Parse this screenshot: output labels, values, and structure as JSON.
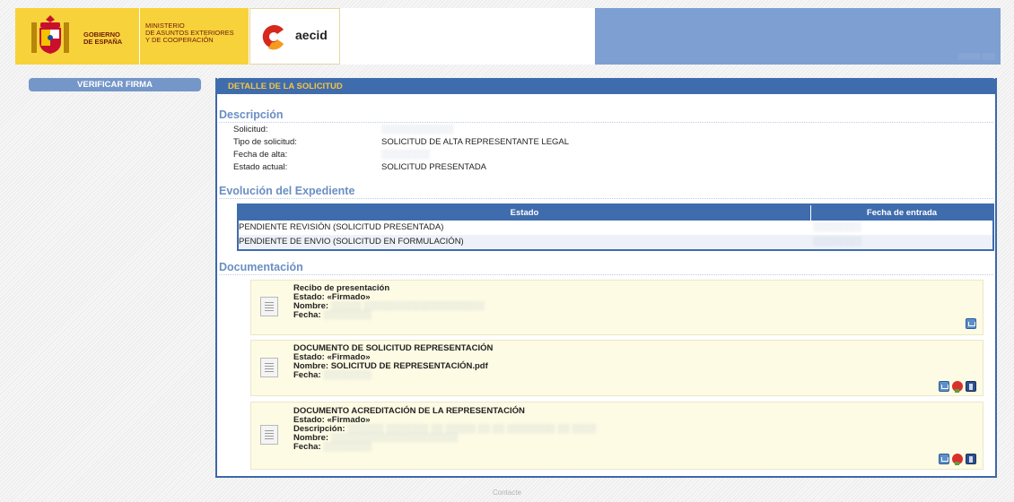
{
  "header": {
    "gobierno_line1": "GOBIERNO",
    "gobierno_line2": "DE ESPAÑA",
    "ministerio_line1": "MINISTERIO",
    "ministerio_line2": "DE ASUNTOS EXTERIORES",
    "ministerio_line3": "Y DE COOPERACIÓN",
    "aecid_label": "aecid",
    "band_text": "░░░░░ ░░░",
    "colors": {
      "gold": "#f8d23a",
      "band": "#7e9fd2",
      "aecid_red": "#d6281e",
      "aecid_orange": "#f49b1e"
    }
  },
  "sidebar": {
    "verify_button_label": "VERIFICAR FIRMA"
  },
  "panel": {
    "title": "DETALLE DE LA SOLICITUD",
    "descripcion": {
      "heading": "Descripción",
      "rows": [
        {
          "label": "Solicitud:",
          "value": "░░░░░░░░░░░░",
          "redacted": true
        },
        {
          "label": "Tipo de solicitud:",
          "value": "SOLICITUD DE ALTA REPRESENTANTE LEGAL",
          "redacted": false
        },
        {
          "label": "Fecha de alta:",
          "value": "░░░░░░░░",
          "redacted": true
        },
        {
          "label": "Estado actual:",
          "value": "SOLICITUD PRESENTADA",
          "redacted": false
        }
      ]
    },
    "evolucion": {
      "heading": "Evolución del Expediente",
      "columns": [
        "Estado",
        "Fecha de entrada"
      ],
      "rows": [
        {
          "estado": "PENDIENTE REVISIÓN (SOLICITUD PRESENTADA)",
          "fecha": "░░░░░░░░"
        },
        {
          "estado": "PENDIENTE DE ENVIO (SOLICITUD EN FORMULACIÓN)",
          "fecha": "░░░░░░░░"
        }
      ]
    },
    "documentacion": {
      "heading": "Documentación",
      "estado_label": "Estado:",
      "nombre_label": "Nombre:",
      "fecha_label": "Fecha:",
      "descripcion_label": "Descripción:",
      "docs": [
        {
          "title": "Recibo de presentación",
          "estado": "«Firmado»",
          "nombre": "░░░░░ ░░░░░░░░░░░░░░░░░░░░",
          "fecha": "░░░░░░░░"
        },
        {
          "title": "DOCUMENTO DE SOLICITUD REPRESENTACIÓN",
          "estado": "«Firmado»",
          "nombre": "SOLICITUD DE REPRESENTACIÓN.pdf",
          "fecha": "░░░░░░░░"
        },
        {
          "title": "DOCUMENTO ACREDITACIÓN DE LA REPRESENTACIÓN",
          "estado": "«Firmado»",
          "descripcion": "░░░░░░ ░░░░░░░ ░░ ░░░░░ ░░ ░░ ░░░░░░░░ ░░ ░░░░",
          "nombre": "░░░░░░░░░░░░░░░░░░░░░",
          "fecha": "░░░░░░░░"
        }
      ]
    }
  },
  "footer": {
    "contact_label": "Contacte"
  }
}
